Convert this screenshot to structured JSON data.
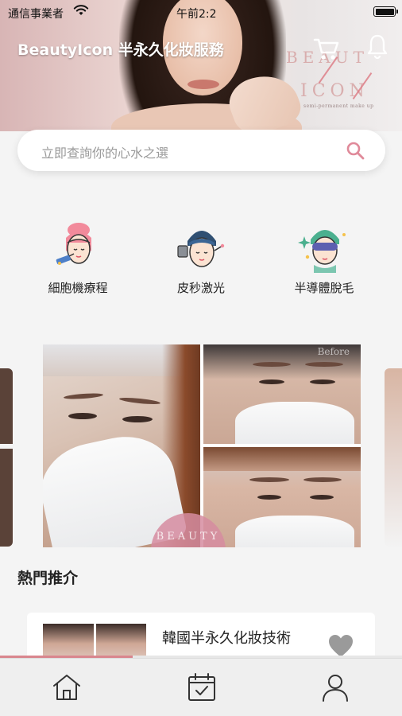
{
  "status_bar": {
    "carrier": "通信事業者",
    "time": "午前2:2",
    "wifi_icon": "wifi-icon",
    "battery_icon": "battery-icon"
  },
  "header": {
    "title": "BeautyIcon 半永久化妝服務",
    "cart_icon": "cart-icon",
    "bell_icon": "bell-icon",
    "watermark_logo": {
      "line1": "BEAUT",
      "line2": "ICON",
      "tagline": "semi-permanent make up"
    }
  },
  "search": {
    "placeholder": "立即查詢你的心水之選",
    "icon": "search-icon",
    "accent_color": "#e08a9a"
  },
  "categories": [
    {
      "label": "細胞機療程",
      "icon": "facial-machine-icon"
    },
    {
      "label": "皮秒激光",
      "icon": "laser-treatment-icon"
    },
    {
      "label": "半導體脫毛",
      "icon": "hair-removal-icon"
    }
  ],
  "carousel": {
    "before_label": "Before",
    "stamp_text": "BEAUTY"
  },
  "popular": {
    "section_title": "熱門推介",
    "items": [
      {
        "title": "韓國半永久化妝技術",
        "favorite_icon": "heart-icon"
      }
    ]
  },
  "bottom_nav": {
    "items": [
      {
        "name": "home",
        "icon": "home-icon"
      },
      {
        "name": "booking",
        "icon": "calendar-icon"
      },
      {
        "name": "profile",
        "icon": "profile-icon"
      }
    ]
  },
  "colors": {
    "accent_pink": "#e08a9a",
    "background": "#f4f4f4",
    "nav_background": "#efefef"
  }
}
